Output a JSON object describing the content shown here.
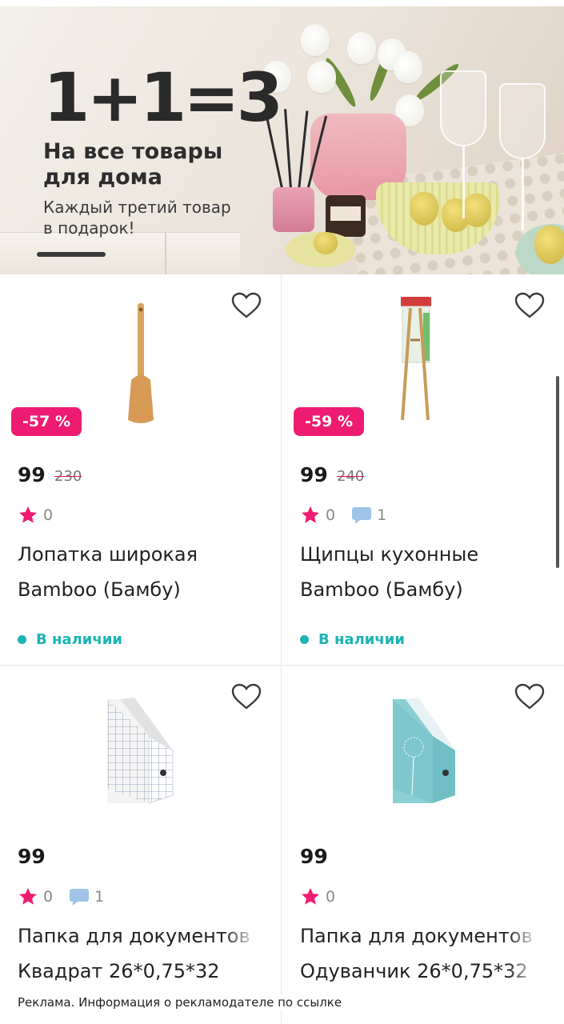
{
  "banner": {
    "headline": "1+1=3",
    "subtitle_line1": "На все товары",
    "subtitle_line2": "для дома",
    "note_line1": "Каждый третий товар",
    "note_line2": "в подарок!"
  },
  "products": [
    {
      "discount": "-57 %",
      "price": "99",
      "old_price": "230",
      "rating": "0",
      "reviews": "",
      "title_line1": "Лопатка широкая",
      "title_line2": "Bamboo (Бамбу)",
      "stock": "В наличии",
      "icon": "wooden-spatula"
    },
    {
      "discount": "-59 %",
      "price": "99",
      "old_price": "240",
      "rating": "0",
      "reviews": "1",
      "title_line1": "Щипцы кухонные",
      "title_line2": "Bamboo (Бамбу)",
      "stock": "В наличии",
      "icon": "bamboo-tongs"
    },
    {
      "price": "99",
      "rating": "0",
      "reviews": "1",
      "title_line1": "Папка для документов",
      "title_line2": "Квадрат 26*0,75*32",
      "icon": "magazine-file-grid"
    },
    {
      "price": "99",
      "rating": "0",
      "title_line1": "Папка для документов",
      "title_line2": "Одуванчик 26*0,75*32",
      "icon": "magazine-file-teal"
    }
  ],
  "ad_disclaimer": "Реклама. Информация о рекламодателе по ссылке",
  "colors": {
    "accent": "#ee1c71",
    "in_stock": "#1bb4b4",
    "review_bubble": "#9fc4e8"
  }
}
